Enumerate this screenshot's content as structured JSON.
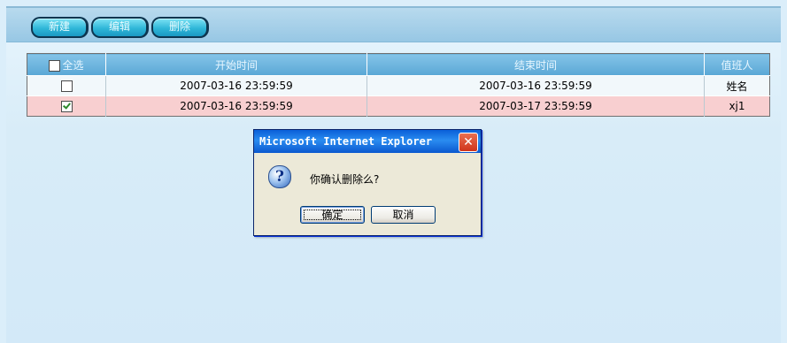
{
  "toolbar": {
    "new_label": "新建",
    "edit_label": "编辑",
    "delete_label": "删除"
  },
  "table": {
    "headers": {
      "select_all": "全选",
      "start_time": "开始时间",
      "end_time": "结束时间",
      "person": "值班人"
    },
    "rows": [
      {
        "checked": false,
        "start": "2007-03-16 23:59:59",
        "end": "2007-03-16 23:59:59",
        "person": "姓名"
      },
      {
        "checked": true,
        "start": "2007-03-16 23:59:59",
        "end": "2007-03-17 23:59:59",
        "person": "xj1"
      }
    ]
  },
  "dialog": {
    "title": "Microsoft Internet Explorer",
    "message": "你确认删除么?",
    "ok_label": "确定",
    "cancel_label": "取消",
    "icon": "question-icon"
  }
}
